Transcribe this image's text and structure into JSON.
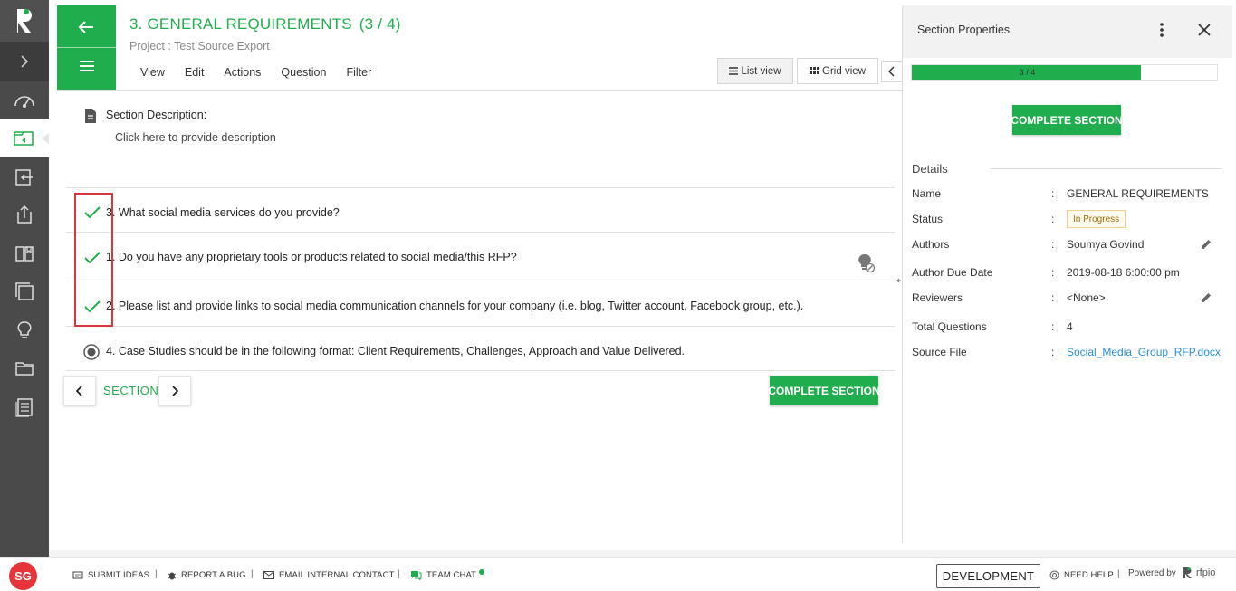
{
  "header": {
    "title": "3. GENERAL REQUIREMENTS",
    "title_count": "(3 / 4)",
    "project_line": "Project : Test Source Export",
    "menu": [
      "View",
      "Edit",
      "Actions",
      "Question",
      "Filter"
    ],
    "list_view_label": "List view",
    "grid_view_label": "Grid view"
  },
  "description": {
    "label": "Section Description:",
    "placeholder_text": "Click here to provide description"
  },
  "questions": [
    {
      "text": "3. What social media services do you provide?",
      "status": "complete"
    },
    {
      "text": "1. Do you have any proprietary tools or products related to social media/this RFP?",
      "status": "complete"
    },
    {
      "text": "2. Please list and provide links to social media communication channels for your company (i.e. blog, Twitter account, Facebook group, etc.).",
      "status": "complete"
    },
    {
      "text": "4. Case Studies should be in the following format: Client Requirements, Challenges, Approach and Value Delivered.",
      "status": "in-progress"
    }
  ],
  "section_nav": {
    "label": "SECTION",
    "complete_label": "COMPLETE SECTION"
  },
  "panel": {
    "title": "Section Properties",
    "progress_label": "3 / 4",
    "progress_fraction": 0.75,
    "complete_label": "COMPLETE SECTION",
    "details_heading": "Details",
    "rows": {
      "name": {
        "key": "Name",
        "value": "GENERAL REQUIREMENTS"
      },
      "status": {
        "key": "Status",
        "value": "In Progress"
      },
      "authors": {
        "key": "Authors",
        "value": "Soumya Govind"
      },
      "due": {
        "key": "Author Due Date",
        "value": "2019-08-18 6:00:00 pm"
      },
      "reviewers": {
        "key": "Reviewers",
        "value": "<None>"
      },
      "total": {
        "key": "Total Questions",
        "value": "4"
      },
      "source": {
        "key": "Source File",
        "value": "Social_Media_Group_RFP.docx"
      }
    },
    "separator": ":"
  },
  "footer": {
    "avatar_initials": "SG",
    "submit_ideas": "SUBMIT IDEAS",
    "report_bug": "REPORT A BUG",
    "email_contact": "EMAIL INTERNAL CONTACT",
    "team_chat": "TEAM CHAT",
    "env_badge": "DEVELOPMENT",
    "need_help": "NEED HELP",
    "powered_by": "Powered by",
    "brand": "rfpio",
    "pipe": "|"
  },
  "colors": {
    "brand_green": "#1fad4d",
    "rail_bg": "#4a4a4a",
    "highlight_red": "#d9363e",
    "link_blue": "#2a8fd6",
    "avatar_red": "#e5343a"
  },
  "icons": {
    "rail": [
      "rfpio-logo-icon",
      "expand-icon",
      "dashboard-icon",
      "projects-icon",
      "import-icon",
      "export-icon",
      "library-icon",
      "documents-icon",
      "insights-icon",
      "folder-icon",
      "reports-icon"
    ]
  }
}
